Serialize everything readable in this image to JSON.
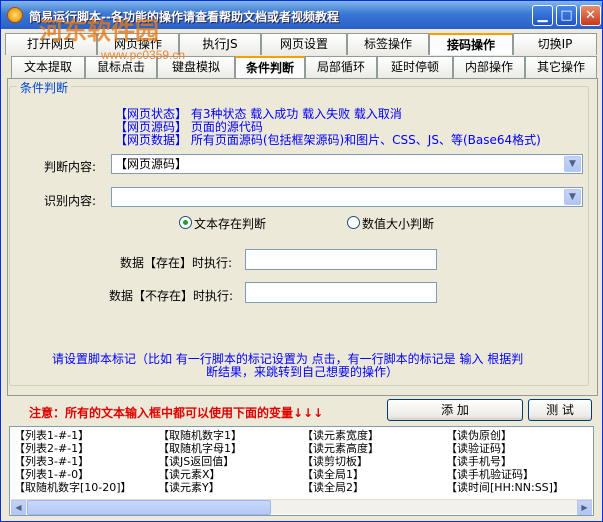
{
  "window": {
    "title": "简易运行脚本--各功能的操作请查看帮助文档或者视频教程",
    "watermark": "河东软件园",
    "watermark_sub": "www.pc0359.cn",
    "min_glyph": "▁",
    "max_glyph": "□",
    "close_glyph": "✕"
  },
  "tabs_row1": [
    "打开网页",
    "网页操作",
    "执行JS",
    "网页设置",
    "标签操作",
    "接码操作",
    "切换IP"
  ],
  "tabs_row1_active": "接码操作",
  "tabs_row2": [
    "文本提取",
    "鼠标点击",
    "键盘模拟",
    "条件判断",
    "局部循环",
    "延时停顿",
    "内部操作",
    "其它操作"
  ],
  "tabs_row2_active": "条件判断",
  "group": {
    "legend": "条件判断",
    "info_lines": [
      "【网页状态】 有3种状态  载入成功  载入失败  载入取消",
      "【网页源码】 页面的源代码",
      "【网页数据】 所有页面源码(包括框架源码)和图片、CSS、JS、等(Base64格式)"
    ],
    "judge_label": "判断内容:",
    "judge_value": "【网页源码】",
    "identify_label": "识别内容:",
    "identify_value": "",
    "radio_text": "文本存在判断",
    "radio_number": "数值大小判断",
    "exist_label": "数据【存在】时执行:",
    "exist_value": "",
    "notexist_label": "数据【不存在】时执行:",
    "notexist_value": "",
    "hint_line1": "请设置脚本标记（比如 有一行脚本的标记设置为  点击，有一行脚本的标记是   输入   根据判",
    "hint_line2": "断结果，来跳转到自己想要的操作）"
  },
  "notice": "注意：所有的文本输入框中都可以使用下面的变量↓↓↓",
  "buttons": {
    "add": "添 加",
    "test": "测 试"
  },
  "variables": {
    "col1": [
      "【列表1-#-1】",
      "【列表2-#-1】",
      "【列表3-#-1】",
      "【列表1-#-0】",
      "【取随机数字[10-20]】"
    ],
    "col2": [
      "【取随机数字1】",
      "【取随机字母1】",
      "【读JS返回值】",
      "【读元素X】",
      "【读元素Y】"
    ],
    "col3": [
      "【读元素宽度】",
      "【读元素高度】",
      "【读剪切板】",
      "【读全局1】",
      "【读全局2】"
    ],
    "col4": [
      "【读伪原创】",
      "【读验证码】",
      "【读手机号】",
      "【读手机验证码】",
      "【读时间[HH:NN:SS]】"
    ]
  },
  "icons": {
    "app": "app-gear-icon",
    "dropdown": "chevron-down-icon",
    "scroll_left": "arrow-left-icon",
    "scroll_right": "arrow-right-icon"
  }
}
